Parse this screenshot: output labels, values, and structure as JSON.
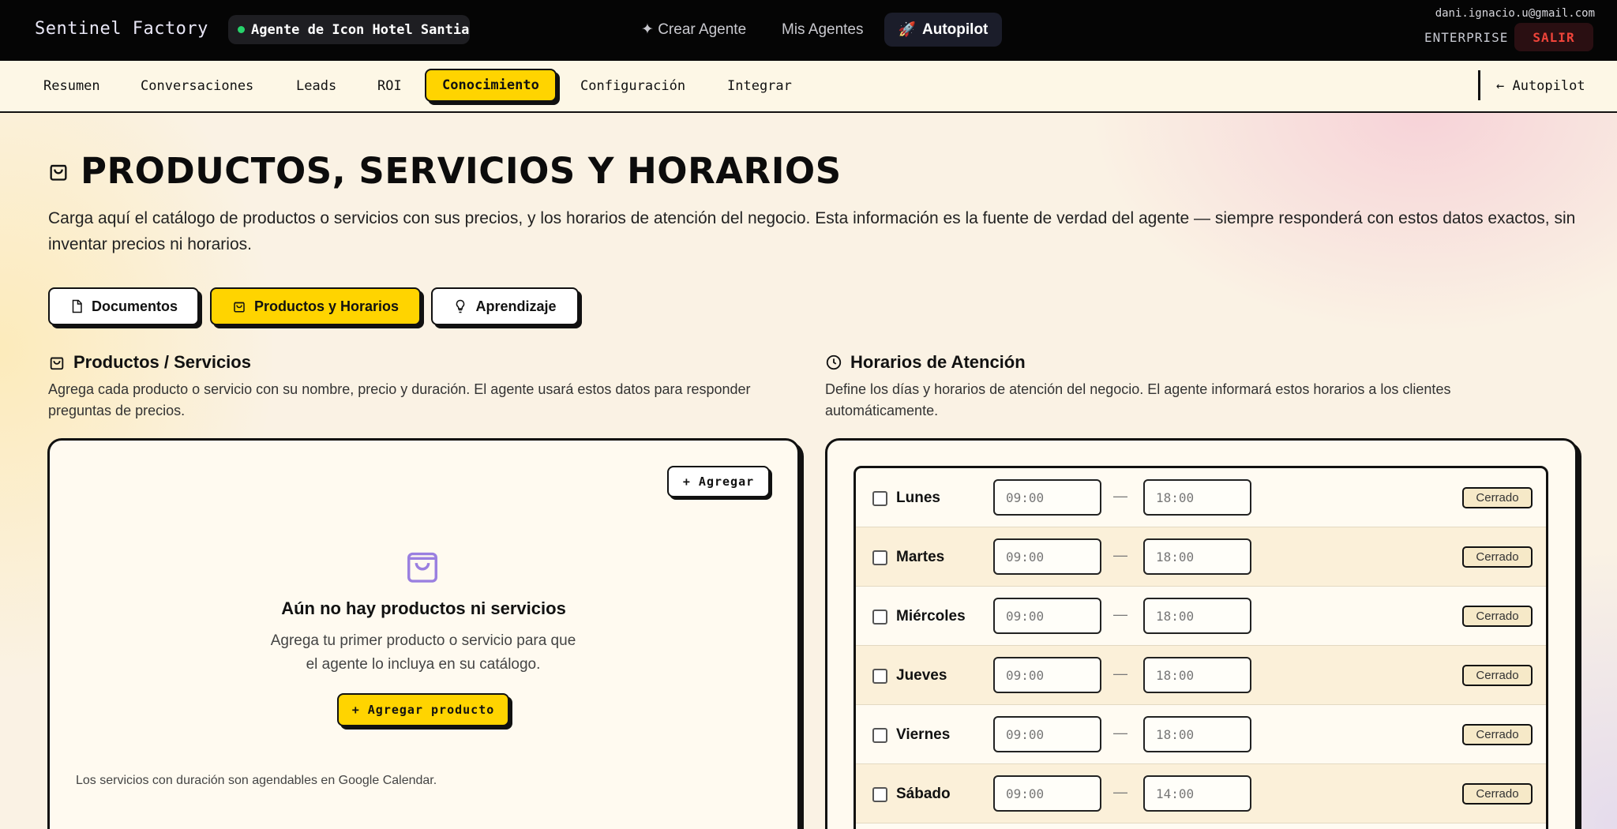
{
  "topbar": {
    "brand": "Sentinel Factory",
    "agent_name": "Agente de Icon Hotel Santiago",
    "nav": {
      "crear": "✦ Crear Agente",
      "mis": "Mis Agentes",
      "autopilot": "Autopilot"
    },
    "email": "dani.ignacio.u@gmail.com",
    "plan": "ENTERPRISE",
    "logout": "SALIR"
  },
  "subnav": {
    "tabs": [
      "Resumen",
      "Conversaciones",
      "Leads",
      "ROI",
      "Conocimiento",
      "Configuración",
      "Integrar"
    ],
    "active": "Conocimiento",
    "back": "← Autopilot"
  },
  "page": {
    "title": "PRODUCTOS, SERVICIOS Y HORARIOS",
    "description": "Carga aquí el catálogo de productos o servicios con sus precios, y los horarios de atención del negocio. Esta información es la fuente de verdad del agente — siempre responderá con estos datos exactos, sin inventar precios ni horarios."
  },
  "knowledge_tabs": {
    "documentos": "Documentos",
    "productos": "Productos y Horarios",
    "aprendizaje": "Aprendizaje"
  },
  "products": {
    "title": "Productos / Servicios",
    "description": "Agrega cada producto o servicio con su nombre, precio y duración. El agente usará estos datos para responder preguntas de precios.",
    "add_button": "+ Agregar",
    "empty_title": "Aún no hay productos ni servicios",
    "empty_sub": "Agrega tu primer producto o servicio para que el agente lo incluya en su catálogo.",
    "add_product_button": "+ Agregar producto",
    "calendar_note": "Los servicios con duración son agendables en Google Calendar."
  },
  "hours": {
    "title": "Horarios de Atención",
    "description": "Define los días y horarios de atención del negocio. El agente informará estos horarios a los clientes automáticamente.",
    "separator": "—",
    "days": [
      {
        "day": "Lunes",
        "open": "09:00",
        "close": "18:00",
        "status": "Cerrado"
      },
      {
        "day": "Martes",
        "open": "09:00",
        "close": "18:00",
        "status": "Cerrado"
      },
      {
        "day": "Miércoles",
        "open": "09:00",
        "close": "18:00",
        "status": "Cerrado"
      },
      {
        "day": "Jueves",
        "open": "09:00",
        "close": "18:00",
        "status": "Cerrado"
      },
      {
        "day": "Viernes",
        "open": "09:00",
        "close": "18:00",
        "status": "Cerrado"
      },
      {
        "day": "Sábado",
        "open": "09:00",
        "close": "14:00",
        "status": "Cerrado"
      }
    ]
  },
  "colors": {
    "accent": "#ffd400",
    "status_dot": "#27d36b",
    "logout_text": "#f0443a",
    "empty_icon": "#9a7fe0"
  }
}
